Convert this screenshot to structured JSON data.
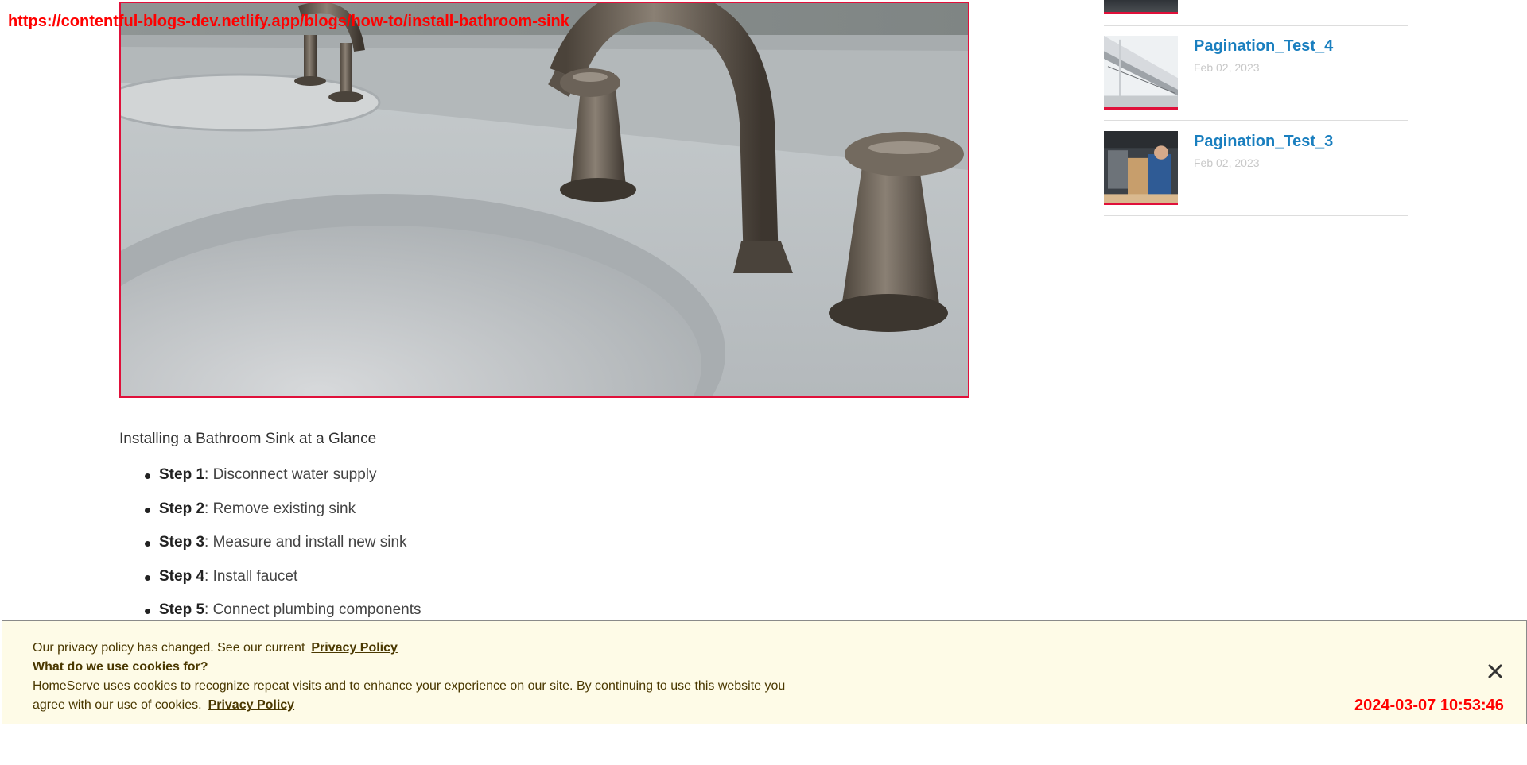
{
  "overlay": {
    "url": "https://contentful-blogs-dev.netlify.app/blogs/how-to/install-bathroom-sink"
  },
  "article": {
    "glance_title": "Installing a Bathroom Sink at a Glance",
    "steps": [
      {
        "label": "Step 1",
        "text": ": Disconnect water supply"
      },
      {
        "label": "Step 2",
        "text": ": Remove existing sink"
      },
      {
        "label": "Step 3",
        "text": ": Measure and install new sink"
      },
      {
        "label": "Step 4",
        "text": ": Install faucet"
      },
      {
        "label": "Step 5",
        "text": ": Connect plumbing components"
      }
    ]
  },
  "sidebar": {
    "items": [
      {
        "title": "Pagination_Test_4",
        "date": "Feb 02, 2023"
      },
      {
        "title": "Pagination_Test_3",
        "date": "Feb 02, 2023"
      }
    ]
  },
  "cookie_banner": {
    "line1": "Our privacy policy has changed. See our current",
    "link1": "Privacy Policy",
    "question": "What do we use cookies for?",
    "body1": "HomeServe uses cookies to recognize repeat visits and to enhance your experience on our site. By continuing to use this website you",
    "body2": "agree with our use of cookies.",
    "link2": "Privacy Policy"
  },
  "timestamp": "2024-03-07 10:53:46",
  "colors": {
    "accent_red": "#e0103a",
    "link_blue": "#1a7fbf",
    "banner_bg": "#fefbe7",
    "banner_text": "#4a3800"
  }
}
